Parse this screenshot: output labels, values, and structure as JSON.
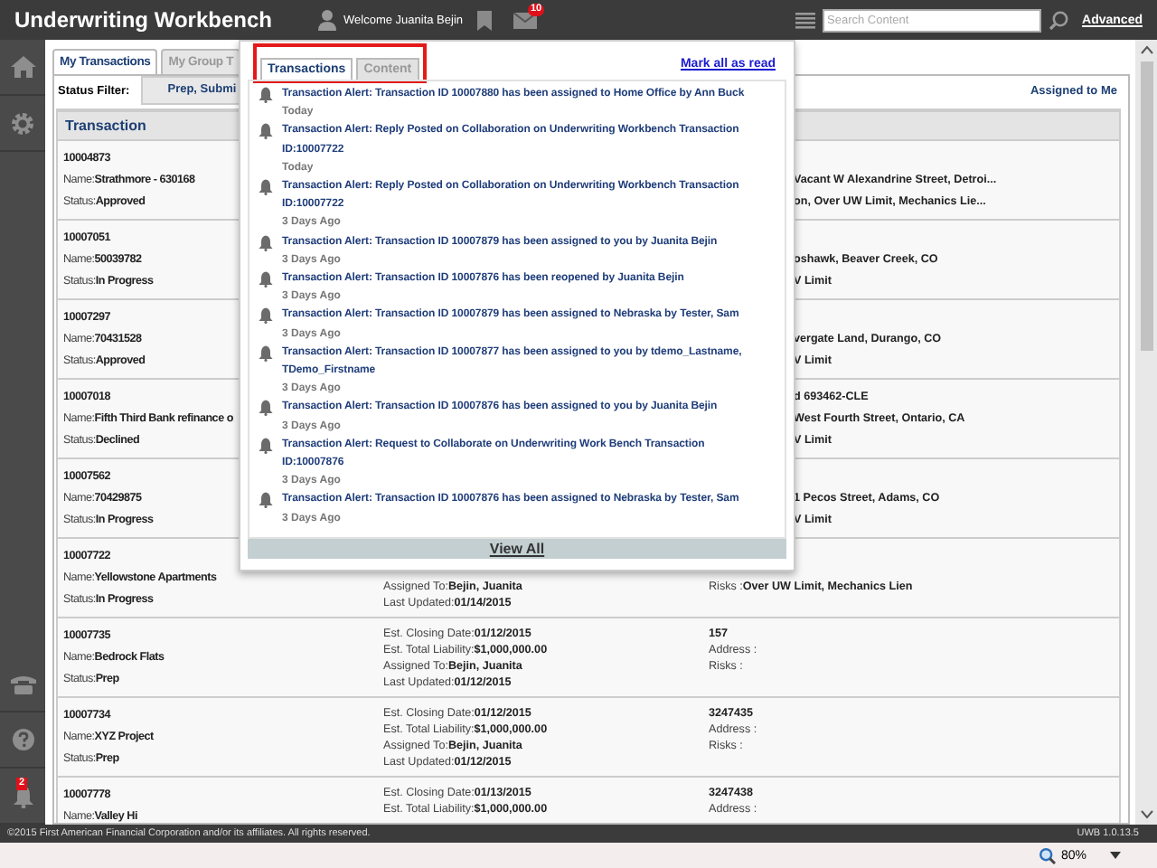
{
  "header": {
    "title": "Underwriting Workbench",
    "welcome": "Welcome Juanita Bejin",
    "mail_badge": "10",
    "search": {
      "placeholder": "Search Content"
    },
    "advanced": "Advanced"
  },
  "sidebar": {
    "bell_badge": "2"
  },
  "tabs": [
    {
      "label": "My Transactions",
      "selected": true
    },
    {
      "label": "My Group T",
      "selected": false
    }
  ],
  "filter": {
    "label": "Status Filter:",
    "value": "Prep, Submi",
    "assigned": "Assigned to Me"
  },
  "table": {
    "columns": [
      "Transaction"
    ],
    "rows": [
      {
        "kind": "clipped",
        "left": [
          {
            "value": "10004873"
          },
          {
            "label": "Name:",
            "value": "Strathmore - 630168"
          },
          {
            "label": "Status:",
            "value": "Approved"
          }
        ],
        "middle": [],
        "right": [
          {
            "value": "Vacant W Alexandrine Street, Detroi..."
          },
          {
            "value": "on, Over UW Limit, Mechanics Lie..."
          }
        ]
      },
      {
        "kind": "clipped",
        "left": [
          {
            "value": "10007051"
          },
          {
            "label": "Name:",
            "value": "50039782"
          },
          {
            "label": "Status:",
            "value": "In Progress"
          }
        ],
        "middle": [],
        "right": [
          {
            "value": "oshawk, Beaver Creek, CO"
          },
          {
            "value": "V Limit"
          }
        ]
      },
      {
        "kind": "clipped",
        "left": [
          {
            "value": "10007297"
          },
          {
            "label": "Name:",
            "value": "70431528"
          },
          {
            "label": "Status:",
            "value": "Approved"
          }
        ],
        "middle": [],
        "right": [
          {
            "value": "vergate Land, Durango, CO"
          },
          {
            "value": "V Limit"
          }
        ]
      },
      {
        "kind": "clipped",
        "left": [
          {
            "value": "10007018"
          },
          {
            "label": "Name:",
            "value": "Fifth Third Bank refinance o"
          },
          {
            "label": "Status:",
            "value": "Declined"
          }
        ],
        "middle": [],
        "right": [
          {
            "value": "d 693462-CLE"
          },
          {
            "value": "West Fourth Street, Ontario, CA"
          },
          {
            "value": "V Limit"
          }
        ]
      },
      {
        "kind": "clipped",
        "left": [
          {
            "value": "10007562"
          },
          {
            "label": "Name:",
            "value": "70429875"
          },
          {
            "label": "Status:",
            "value": "In Progress"
          }
        ],
        "middle": [],
        "right": [
          {
            "value": "1 Pecos Street, Adams, CO"
          },
          {
            "value": "V Limit"
          }
        ]
      },
      {
        "kind": "partial",
        "left": [
          {
            "value": "10007722"
          },
          {
            "label": "Name:",
            "value": "Yellowstone Apartments"
          },
          {
            "label": "Status:",
            "value": "In Progress"
          }
        ],
        "middle": [
          {
            "label": "Assigned To:",
            "value": "Bejin, Juanita"
          },
          {
            "label": "Last Updated:",
            "value": "01/14/2015"
          }
        ],
        "right": [
          {
            "label": "Risks :",
            "value": "Over UW Limit, Mechanics Lien"
          }
        ]
      },
      {
        "kind": "full",
        "left": [
          {
            "value": "10007735"
          },
          {
            "label": "Name:",
            "value": "Bedrock Flats"
          },
          {
            "label": "Status:",
            "value": "Prep"
          }
        ],
        "middle": [
          {
            "label": "Est. Closing Date:",
            "value": "01/12/2015"
          },
          {
            "label": "Est. Total Liability:",
            "value": "$1,000,000.00"
          },
          {
            "label": "Assigned To:",
            "value": "Bejin, Juanita"
          },
          {
            "label": "Last Updated:",
            "value": "01/12/2015"
          }
        ],
        "right": [
          {
            "value": "157"
          },
          {
            "label": "Address :"
          },
          {
            "label": "Risks :"
          }
        ]
      },
      {
        "kind": "full",
        "left": [
          {
            "value": "10007734"
          },
          {
            "label": "Name:",
            "value": "XYZ Project"
          },
          {
            "label": "Status:",
            "value": "Prep"
          }
        ],
        "middle": [
          {
            "label": "Est. Closing Date:",
            "value": "01/12/2015"
          },
          {
            "label": "Est. Total Liability:",
            "value": "$1,000,000.00"
          },
          {
            "label": "Assigned To:",
            "value": "Bejin, Juanita"
          },
          {
            "label": "Last Updated:",
            "value": "01/12/2015"
          }
        ],
        "right": [
          {
            "value": "3247435"
          },
          {
            "label": "Address :"
          },
          {
            "label": "Risks :"
          }
        ]
      },
      {
        "kind": "full",
        "left": [
          {
            "value": "10007778"
          },
          {
            "label": "Name:",
            "value": "Valley Hi"
          }
        ],
        "middle": [
          {
            "label": "Est. Closing Date:",
            "value": "01/13/2015"
          },
          {
            "label": "Est. Total Liability:",
            "value": "$1,000,000.00"
          }
        ],
        "right": [
          {
            "value": "3247438"
          },
          {
            "label": "Address :"
          }
        ]
      }
    ]
  },
  "popup": {
    "tabs": [
      {
        "label": "Transactions",
        "selected": true
      },
      {
        "label": "Content",
        "selected": false
      }
    ],
    "mark_all": "Mark all as read",
    "alerts": [
      {
        "text": "Transaction Alert: Transaction ID 10007880 has been assigned to Home Office by Ann Buck",
        "time": "Today"
      },
      {
        "text": "Transaction Alert: Reply Posted on Collaboration on Underwriting Workbench Transaction ID:10007722",
        "time": "Today"
      },
      {
        "text": "Transaction Alert: Reply Posted on Collaboration on Underwriting Workbench Transaction ID:10007722",
        "time": "3 Days Ago"
      },
      {
        "text": "Transaction Alert: Transaction ID 10007879 has been assigned to you by Juanita Bejin",
        "time": "3 Days Ago"
      },
      {
        "text": "Transaction Alert: Transaction ID 10007876 has been reopened by Juanita Bejin",
        "time": "3 Days Ago"
      },
      {
        "text": "Transaction Alert: Transaction ID 10007879 has been assigned to Nebraska by Tester, Sam",
        "time": "3 Days Ago"
      },
      {
        "text": "Transaction Alert: Transaction ID 10007877 has been assigned to you by tdemo_Lastname, TDemo_Firstname",
        "time": "3 Days Ago"
      },
      {
        "text": "Transaction Alert: Transaction ID 10007876 has been assigned to you by Juanita Bejin",
        "time": "3 Days Ago"
      },
      {
        "text": "Transaction Alert: Request to Collaborate on Underwriting Work Bench Transaction ID:10007876",
        "time": "3 Days Ago"
      },
      {
        "text": "Transaction Alert: Transaction ID 10007876 has been assigned to Nebraska by Tester, Sam",
        "time": "3 Days Ago"
      }
    ],
    "view_all": "View All"
  },
  "footer": {
    "copyright": "©2015 First American Financial Corporation and/or its affiliates. All rights reserved.",
    "version": "UWB 1.0.13.5"
  },
  "status_bar": {
    "zoom": "80%"
  }
}
